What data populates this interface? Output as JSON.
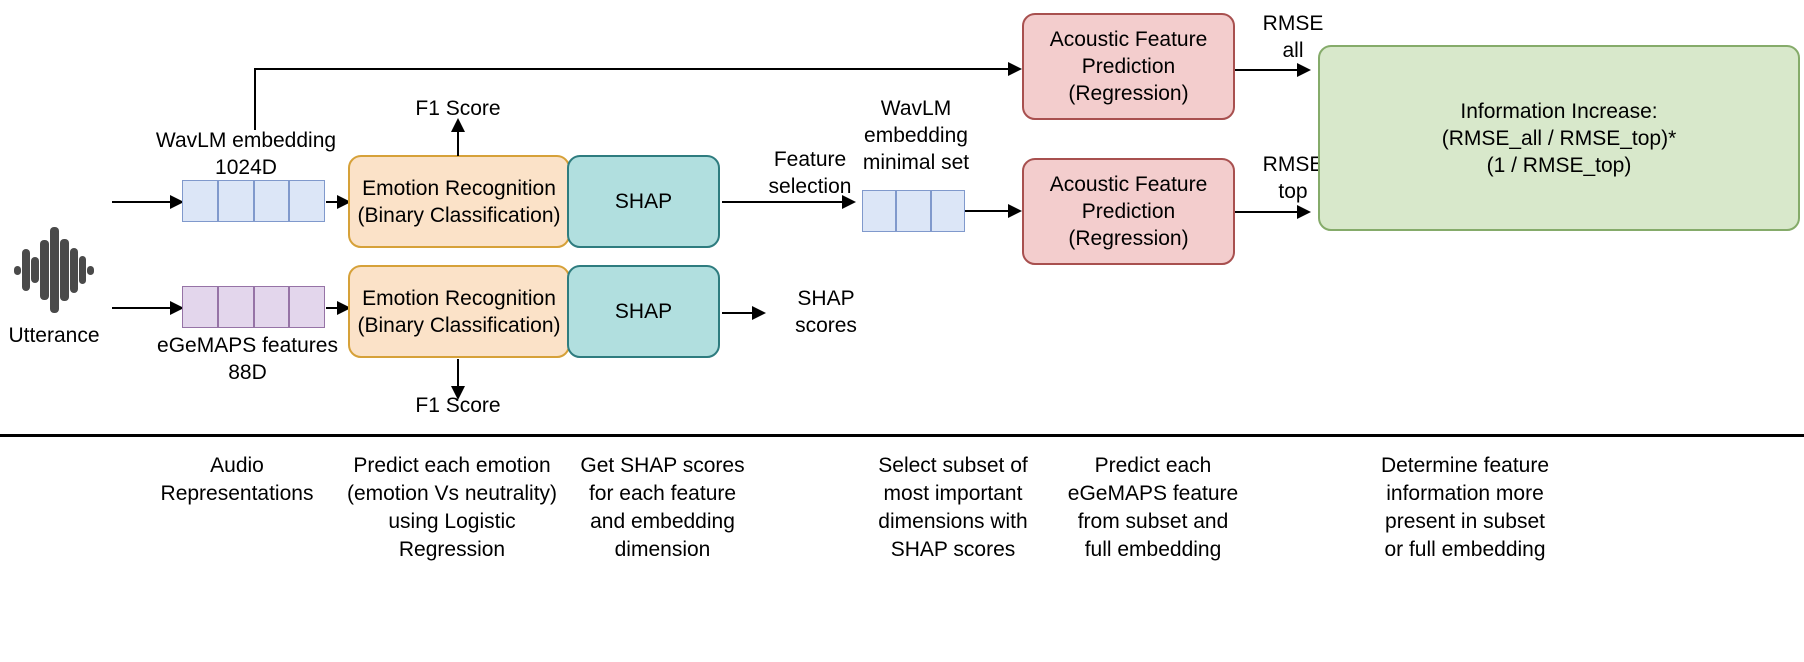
{
  "diagram": {
    "title": "Emotion recognition feature attribution pipeline",
    "colors": {
      "orange_fill": "#fbe2c8",
      "orange_border": "#d6a139",
      "teal_fill": "#b1dfdf",
      "teal_border": "#2e7c7f",
      "pink_fill": "#f3cdcd",
      "pink_border": "#a8504f",
      "green_fill": "#d8e8cb",
      "green_border": "#85ab6a",
      "blue_fill": "#dce6f7",
      "blue_border": "#8099cc",
      "purple_fill": "#e3d6ec",
      "purple_border": "#9673a6",
      "line": "#000000",
      "waveform": "#4a4a4a"
    },
    "input": {
      "utterance_label": "Utterance",
      "waveform_icon": "audio-waveform-icon"
    },
    "embeddings": {
      "wavlm": {
        "label": "WavLM embedding\n1024D",
        "cells": 4
      },
      "egemaps": {
        "label": "eGeMAPS features\n88D",
        "cells": 4
      },
      "wavlm_minimal": {
        "label": "WavLM\nembedding\nminimal set",
        "cells": 3
      }
    },
    "boxes": {
      "emotion_recognition_top": "Emotion Recognition\n(Binary Classification)",
      "emotion_recognition_bottom": "Emotion Recognition\n(Binary Classification)",
      "shap_top": "SHAP",
      "shap_bottom": "SHAP",
      "acoustic_prediction_top": "Acoustic Feature\nPrediction\n(Regression)",
      "acoustic_prediction_bottom": "Acoustic Feature\nPrediction\n(Regression)",
      "information_increase": "Information Increase:\n(RMSE_all / RMSE_top)*\n(1 / RMSE_top)"
    },
    "edge_labels": {
      "f1_score_top": "F1 Score",
      "f1_score_bottom": "F1 Score",
      "feature_selection": "Feature\nselection",
      "shap_scores": "SHAP\nscores",
      "rmse_all": "RMSE\nall",
      "rmse_top": "RMSE\ntop"
    },
    "captions": [
      "Audio\nRepresentations",
      "Predict each emotion\n(emotion Vs neutrality)\nusing Logistic\nRegression",
      "Get SHAP scores\nfor each feature\nand embedding\ndimension",
      "Select subset of\nmost important\ndimensions with\nSHAP scores",
      "Predict each\neGeMAPS feature\nfrom subset and\nfull embedding",
      "Determine feature\ninformation more\npresent in subset\nor full embedding"
    ]
  }
}
